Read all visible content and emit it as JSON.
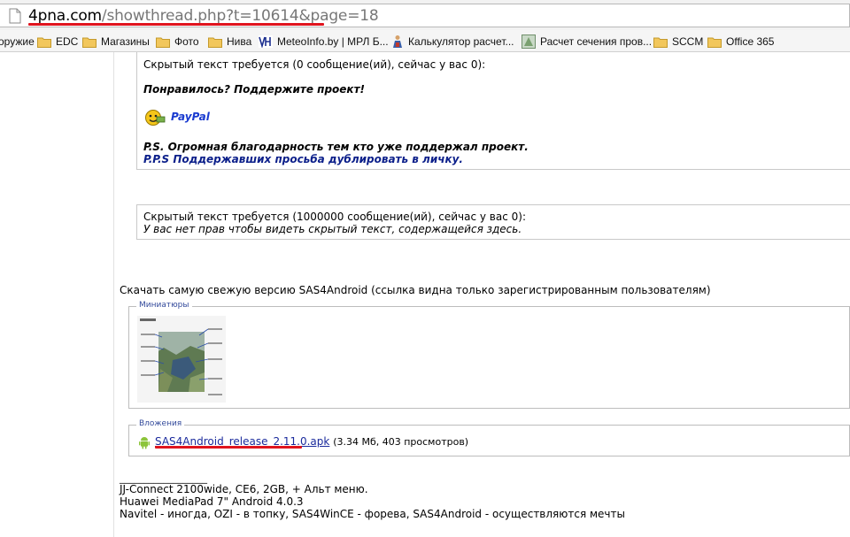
{
  "address_bar": {
    "url_host": "4pna.com",
    "url_path": "/showthread.php?t=10614&page=18",
    "icon": "page-icon"
  },
  "bookmarks": [
    {
      "label": "оружие",
      "icon": "none"
    },
    {
      "label": "EDC",
      "icon": "folder-icon"
    },
    {
      "label": "Магазины",
      "icon": "folder-icon"
    },
    {
      "label": "Фото",
      "icon": "folder-icon"
    },
    {
      "label": "Нива",
      "icon": "folder-icon"
    },
    {
      "label": "MeteoInfo.by | МРЛ Б...",
      "icon": "meteo-icon"
    },
    {
      "label": "Калькулятор расчет...",
      "icon": "calculator-icon"
    },
    {
      "label": "Расчет сечения пров...",
      "icon": "cable-icon"
    },
    {
      "label": "SCCM",
      "icon": "folder-icon"
    },
    {
      "label": "Office 365",
      "icon": "folder-icon"
    }
  ],
  "post": {
    "hidden_box_1": {
      "header": "Скрытый текст требуется (0 сообщение(ий), сейчас у вас 0):",
      "support_text": "Понравилось? Поддержите проект!",
      "paypal_label": "PayPal",
      "ps_text": "P.S. Огромная благодарность тем кто уже поддержал проект.",
      "pps_text": "P.P.S Поддержавших просьба дублировать в личку."
    },
    "hidden_box_2": {
      "header": "Скрытый текст требуется (1000000 сообщение(ий), сейчас у вас 0):",
      "notice": "У вас нет прав чтобы видеть скрытый текст, содержащейся здесь."
    },
    "download_text": "Скачать самую свежую версию SAS4Android (ссылка видна только зарегистрированным пользователям)",
    "thumbnails": {
      "legend": "Миниатюры"
    },
    "attachments": {
      "legend": "Вложения",
      "file_name": "SAS4Android_release_2.11.0.apk",
      "file_meta": "(3.34 Мб, 403 просмотров)"
    },
    "signature": {
      "divider": "__________________",
      "line1": "JJ-Connect 2100wide, CE6, 2GB, + Альт меню.",
      "line2": "Huawei MediaPad 7\" Android 4.0.3",
      "line3": "Navitel - иногда, OZI - в топку, SAS4WinCE - форева, SAS4Android - осуществляются мечты"
    }
  },
  "colors": {
    "accent_red": "#e0141e",
    "link_blue": "#1a2a9c",
    "legend_blue": "#334a9b"
  }
}
